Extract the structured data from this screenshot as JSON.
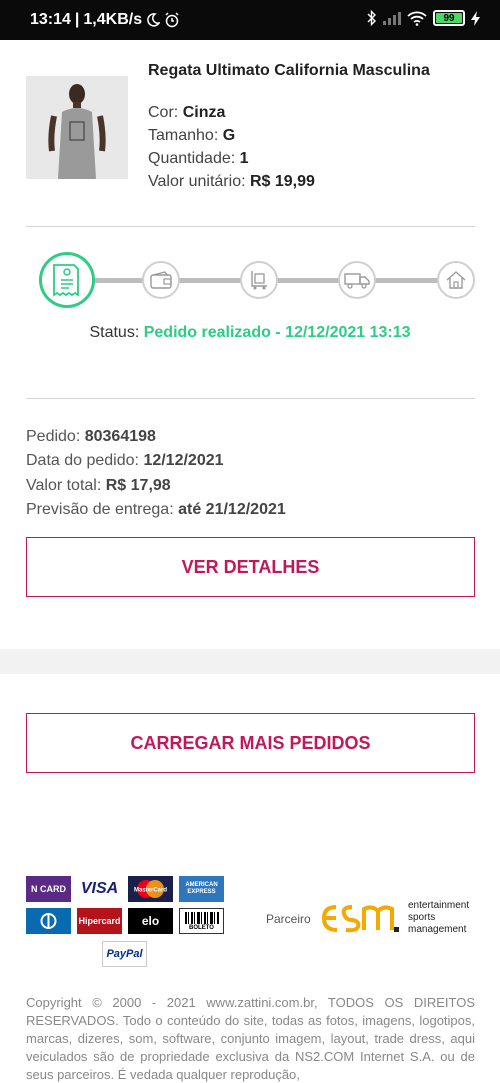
{
  "status_bar": {
    "time": "13:14",
    "speed": "1,4KB/s",
    "battery": "99",
    "battery_level_percent": 99,
    "icons": [
      "moon-icon",
      "alarm-icon",
      "bluetooth-icon",
      "signal-icon",
      "wifi-icon",
      "battery-icon",
      "charging-icon"
    ]
  },
  "product": {
    "name": "Regata Ultimato California Masculina",
    "color_label": "Cor:",
    "color_value": "Cinza",
    "size_label": "Tamanho:",
    "size_value": "G",
    "quantity_label": "Quantidade:",
    "quantity_value": "1",
    "unit_price_label": "Valor unitário:",
    "unit_price_value": "R$ 19,99"
  },
  "tracker": {
    "steps": [
      {
        "icon": "receipt-icon",
        "active": true
      },
      {
        "icon": "wallet-icon",
        "active": false
      },
      {
        "icon": "package-trolley-icon",
        "active": false
      },
      {
        "icon": "delivery-truck-icon",
        "active": false
      },
      {
        "icon": "house-icon",
        "active": false
      }
    ],
    "status_label": "Status:",
    "status_value": "Pedido realizado - 12/12/2021 13:13"
  },
  "order": {
    "number_label": "Pedido:",
    "number_value": "80364198",
    "date_label": "Data do pedido:",
    "date_value": "12/12/2021",
    "total_label": "Valor total:",
    "total_value": "R$ 17,98",
    "delivery_label": "Previsão de entrega:",
    "delivery_value": "até 21/12/2021",
    "details_button": "VER DETALHES"
  },
  "load_more_button": "CARREGAR MAIS PEDIDOS",
  "footer": {
    "payments": {
      "ncard": "N CARD",
      "visa": "VISA",
      "mastercard": "MasterCard",
      "amex": "AMERICAN EXPRESS",
      "diners": "Diners",
      "hipercard": "Hipercard",
      "elo": "elo",
      "boleto": "BOLETO",
      "paypal": "PayPal"
    },
    "partner_label": "Parceiro",
    "partner_lines": [
      "entertainment",
      "sports",
      "management"
    ],
    "copyright": "Copyright © 2000 - 2021 www.zattini.com.br, TODOS OS DIREITOS RESERVADOS. Todo o conteúdo do site, todas as fotos, imagens, logotipos, marcas, dizeres, som, software, conjunto imagem, layout, trade dress, aqui veiculados são de propriedade exclusiva da NS2.COM Internet S.A. ou de seus parceiros. É vedada qualquer reprodução,"
  },
  "colors": {
    "accent": "#c2185b",
    "status_green": "#2ecc85",
    "divider": "#d4d4d4"
  }
}
